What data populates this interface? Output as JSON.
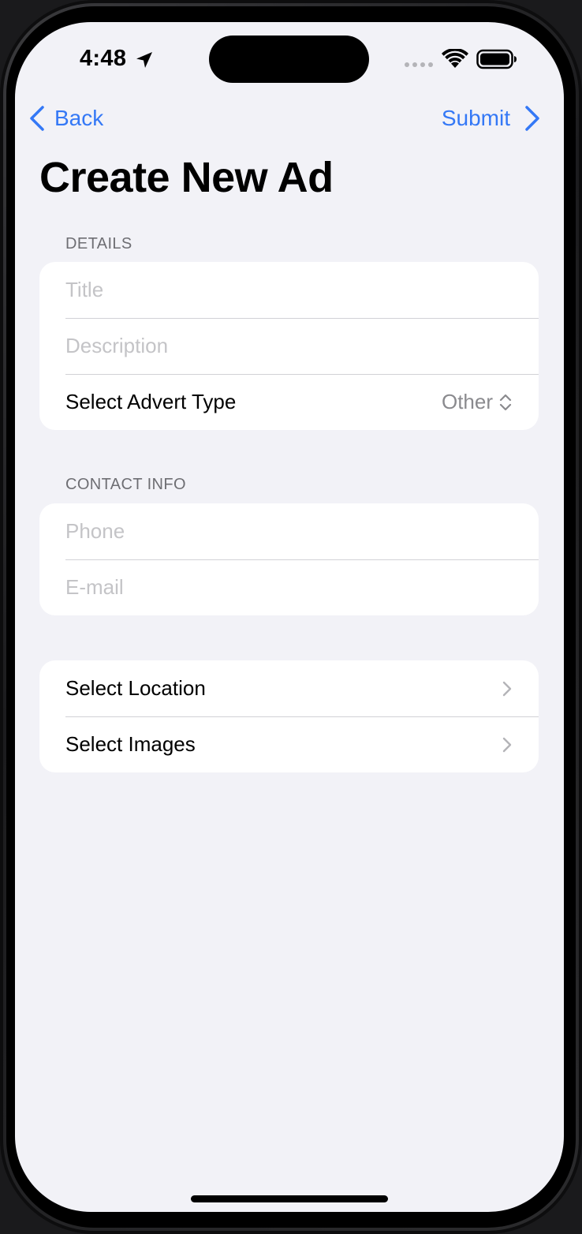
{
  "status_bar": {
    "time": "4:48"
  },
  "nav": {
    "back_label": "Back",
    "submit_label": "Submit"
  },
  "page": {
    "title": "Create New Ad"
  },
  "details_section": {
    "header": "DETAILS",
    "title_placeholder": "Title",
    "description_placeholder": "Description",
    "advert_type_label": "Select Advert Type",
    "advert_type_value": "Other"
  },
  "contact_section": {
    "header": "CONTACT INFO",
    "phone_placeholder": "Phone",
    "email_placeholder": "E-mail"
  },
  "links_section": {
    "location_label": "Select Location",
    "images_label": "Select Images"
  },
  "colors": {
    "accent": "#3478f6",
    "background": "#f2f2f7",
    "card": "#ffffff",
    "placeholder": "#c4c4c7",
    "secondary_text": "#8a8a8e"
  },
  "icons": {
    "location": "location-arrow-icon",
    "signal": "cellular-signal-icon",
    "wifi": "wifi-icon",
    "battery": "battery-icon",
    "back": "chevron-left-icon",
    "submit": "chevron-right-icon",
    "picker": "up-down-chevron-icon",
    "disclosure": "chevron-right-icon"
  }
}
